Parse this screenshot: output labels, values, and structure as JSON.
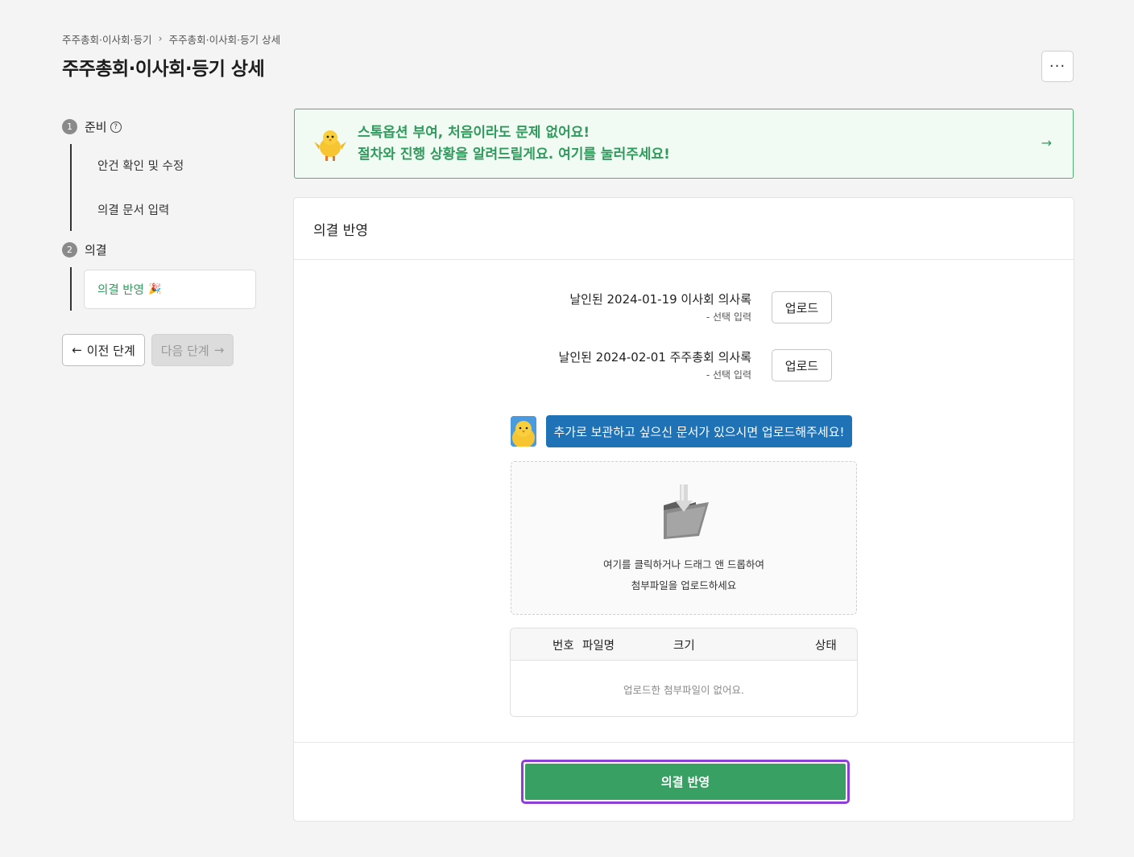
{
  "breadcrumb": {
    "parent": "주주총회·이사회·등기",
    "current": "주주총회·이사회·등기 상세"
  },
  "page_title": "주주총회·이사회·등기 상세",
  "more_button": "···",
  "steps": [
    {
      "number": "1",
      "label": "준비",
      "help": "?",
      "items": [
        "안건 확인 및 수정",
        "의결 문서 입력"
      ]
    },
    {
      "number": "2",
      "label": "의결",
      "items": [
        "의결 반영"
      ]
    }
  ],
  "nav": {
    "prev_label": "이전 단계",
    "next_label": "다음 단계",
    "prev_arrow": "←",
    "next_arrow": "→"
  },
  "banner": {
    "line1": "스톡옵션 부여, 처음이라도 문제 없어요!",
    "line2": "절차와 진행 상황을 알려드릴게요. 여기를 눌러주세요!",
    "arrow": "→"
  },
  "card": {
    "title": "의결 반영",
    "documents": [
      {
        "label": "날인된 2024-01-19 이사회 의사록",
        "sub": "- 선택 입력",
        "button": "업로드"
      },
      {
        "label": "날인된 2024-02-01 주주총회 의사록",
        "sub": "- 선택 입력",
        "button": "업로드"
      }
    ],
    "speech": "추가로 보관하고 싶으신 문서가 있으시면 업로드해주세요!",
    "dropzone": {
      "line1": "여기를 클릭하거나 드래그 앤 드롭하여",
      "line2": "첨부파일을 업로드하세요"
    },
    "table": {
      "columns": [
        "번호",
        "파일명",
        "크기",
        "상태"
      ],
      "empty": "업로드한 첨부파일이 없어요."
    },
    "submit_label": "의결 반영"
  },
  "colors": {
    "accent_green": "#38a063",
    "highlight_purple": "#8c3fd6",
    "speech_blue": "#1f72b6"
  }
}
